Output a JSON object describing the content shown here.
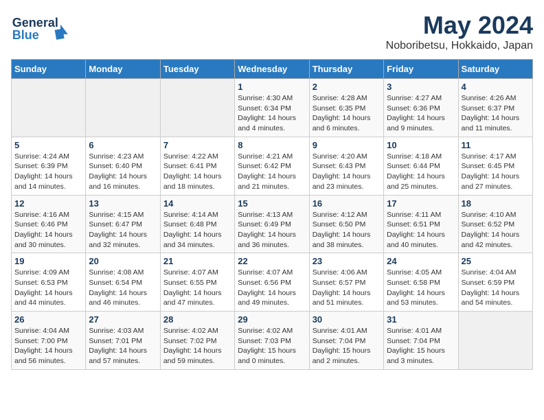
{
  "header": {
    "logo_line1": "General",
    "logo_line2": "Blue",
    "title": "May 2024",
    "subtitle": "Noboribetsu, Hokkaido, Japan"
  },
  "calendar": {
    "columns": [
      "Sunday",
      "Monday",
      "Tuesday",
      "Wednesday",
      "Thursday",
      "Friday",
      "Saturday"
    ],
    "weeks": [
      [
        {
          "day": "",
          "info": ""
        },
        {
          "day": "",
          "info": ""
        },
        {
          "day": "",
          "info": ""
        },
        {
          "day": "1",
          "info": "Sunrise: 4:30 AM\nSunset: 6:34 PM\nDaylight: 14 hours\nand 4 minutes."
        },
        {
          "day": "2",
          "info": "Sunrise: 4:28 AM\nSunset: 6:35 PM\nDaylight: 14 hours\nand 6 minutes."
        },
        {
          "day": "3",
          "info": "Sunrise: 4:27 AM\nSunset: 6:36 PM\nDaylight: 14 hours\nand 9 minutes."
        },
        {
          "day": "4",
          "info": "Sunrise: 4:26 AM\nSunset: 6:37 PM\nDaylight: 14 hours\nand 11 minutes."
        }
      ],
      [
        {
          "day": "5",
          "info": "Sunrise: 4:24 AM\nSunset: 6:39 PM\nDaylight: 14 hours\nand 14 minutes."
        },
        {
          "day": "6",
          "info": "Sunrise: 4:23 AM\nSunset: 6:40 PM\nDaylight: 14 hours\nand 16 minutes."
        },
        {
          "day": "7",
          "info": "Sunrise: 4:22 AM\nSunset: 6:41 PM\nDaylight: 14 hours\nand 18 minutes."
        },
        {
          "day": "8",
          "info": "Sunrise: 4:21 AM\nSunset: 6:42 PM\nDaylight: 14 hours\nand 21 minutes."
        },
        {
          "day": "9",
          "info": "Sunrise: 4:20 AM\nSunset: 6:43 PM\nDaylight: 14 hours\nand 23 minutes."
        },
        {
          "day": "10",
          "info": "Sunrise: 4:18 AM\nSunset: 6:44 PM\nDaylight: 14 hours\nand 25 minutes."
        },
        {
          "day": "11",
          "info": "Sunrise: 4:17 AM\nSunset: 6:45 PM\nDaylight: 14 hours\nand 27 minutes."
        }
      ],
      [
        {
          "day": "12",
          "info": "Sunrise: 4:16 AM\nSunset: 6:46 PM\nDaylight: 14 hours\nand 30 minutes."
        },
        {
          "day": "13",
          "info": "Sunrise: 4:15 AM\nSunset: 6:47 PM\nDaylight: 14 hours\nand 32 minutes."
        },
        {
          "day": "14",
          "info": "Sunrise: 4:14 AM\nSunset: 6:48 PM\nDaylight: 14 hours\nand 34 minutes."
        },
        {
          "day": "15",
          "info": "Sunrise: 4:13 AM\nSunset: 6:49 PM\nDaylight: 14 hours\nand 36 minutes."
        },
        {
          "day": "16",
          "info": "Sunrise: 4:12 AM\nSunset: 6:50 PM\nDaylight: 14 hours\nand 38 minutes."
        },
        {
          "day": "17",
          "info": "Sunrise: 4:11 AM\nSunset: 6:51 PM\nDaylight: 14 hours\nand 40 minutes."
        },
        {
          "day": "18",
          "info": "Sunrise: 4:10 AM\nSunset: 6:52 PM\nDaylight: 14 hours\nand 42 minutes."
        }
      ],
      [
        {
          "day": "19",
          "info": "Sunrise: 4:09 AM\nSunset: 6:53 PM\nDaylight: 14 hours\nand 44 minutes."
        },
        {
          "day": "20",
          "info": "Sunrise: 4:08 AM\nSunset: 6:54 PM\nDaylight: 14 hours\nand 46 minutes."
        },
        {
          "day": "21",
          "info": "Sunrise: 4:07 AM\nSunset: 6:55 PM\nDaylight: 14 hours\nand 47 minutes."
        },
        {
          "day": "22",
          "info": "Sunrise: 4:07 AM\nSunset: 6:56 PM\nDaylight: 14 hours\nand 49 minutes."
        },
        {
          "day": "23",
          "info": "Sunrise: 4:06 AM\nSunset: 6:57 PM\nDaylight: 14 hours\nand 51 minutes."
        },
        {
          "day": "24",
          "info": "Sunrise: 4:05 AM\nSunset: 6:58 PM\nDaylight: 14 hours\nand 53 minutes."
        },
        {
          "day": "25",
          "info": "Sunrise: 4:04 AM\nSunset: 6:59 PM\nDaylight: 14 hours\nand 54 minutes."
        }
      ],
      [
        {
          "day": "26",
          "info": "Sunrise: 4:04 AM\nSunset: 7:00 PM\nDaylight: 14 hours\nand 56 minutes."
        },
        {
          "day": "27",
          "info": "Sunrise: 4:03 AM\nSunset: 7:01 PM\nDaylight: 14 hours\nand 57 minutes."
        },
        {
          "day": "28",
          "info": "Sunrise: 4:02 AM\nSunset: 7:02 PM\nDaylight: 14 hours\nand 59 minutes."
        },
        {
          "day": "29",
          "info": "Sunrise: 4:02 AM\nSunset: 7:03 PM\nDaylight: 15 hours\nand 0 minutes."
        },
        {
          "day": "30",
          "info": "Sunrise: 4:01 AM\nSunset: 7:04 PM\nDaylight: 15 hours\nand 2 minutes."
        },
        {
          "day": "31",
          "info": "Sunrise: 4:01 AM\nSunset: 7:04 PM\nDaylight: 15 hours\nand 3 minutes."
        },
        {
          "day": "",
          "info": ""
        }
      ]
    ]
  }
}
